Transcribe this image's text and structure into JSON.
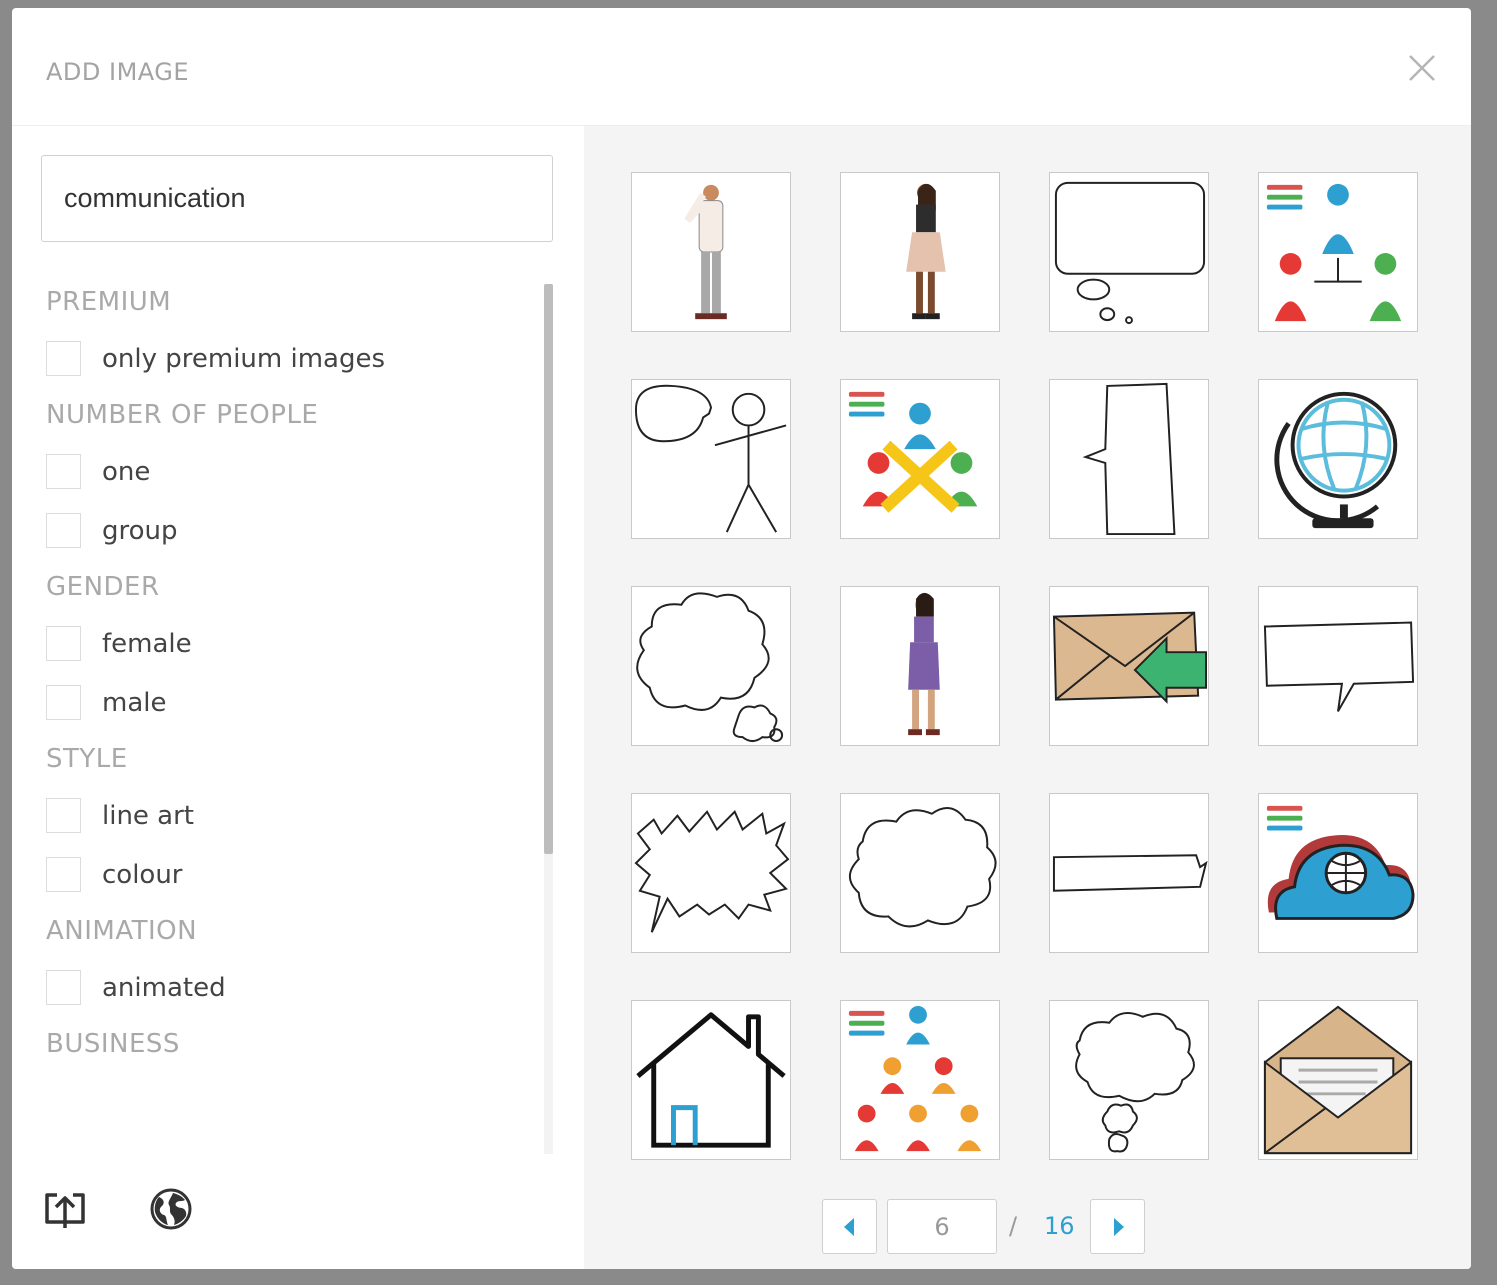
{
  "dialog": {
    "title": "ADD IMAGE",
    "close_icon": "close-icon"
  },
  "search": {
    "value": "communication"
  },
  "filters": [
    {
      "title": "PREMIUM",
      "options": [
        "only premium images"
      ]
    },
    {
      "title": "NUMBER OF PEOPLE",
      "options": [
        "one",
        "group"
      ]
    },
    {
      "title": "GENDER",
      "options": [
        "female",
        "male"
      ]
    },
    {
      "title": "STYLE",
      "options": [
        "line art",
        "colour"
      ]
    },
    {
      "title": "ANIMATION",
      "options": [
        "animated"
      ]
    },
    {
      "title": "BUSINESS",
      "options": []
    }
  ],
  "bottom_icons": [
    "upload-icon",
    "globe-icon"
  ],
  "images": [
    "man-on-phone",
    "woman-on-phone",
    "thought-bubble-rect",
    "team-hierarchy",
    "stick-figure-speech",
    "group-discussion",
    "tall-speech-bubble",
    "globe",
    "cloud-thought-bubble",
    "woman-purple-dress-phone",
    "envelope-incoming",
    "wide-speech-bubble",
    "spiky-speech-bubble",
    "cloud-bubble",
    "banner-bubble",
    "cloud-network",
    "house-outline",
    "org-chart",
    "thought-cloud-puffs",
    "open-envelope-letter"
  ],
  "pagination": {
    "current": "6",
    "separator": "/",
    "total": "16"
  },
  "colors": {
    "accent": "#2d9fd0",
    "muted_text": "#a9a9a9"
  }
}
